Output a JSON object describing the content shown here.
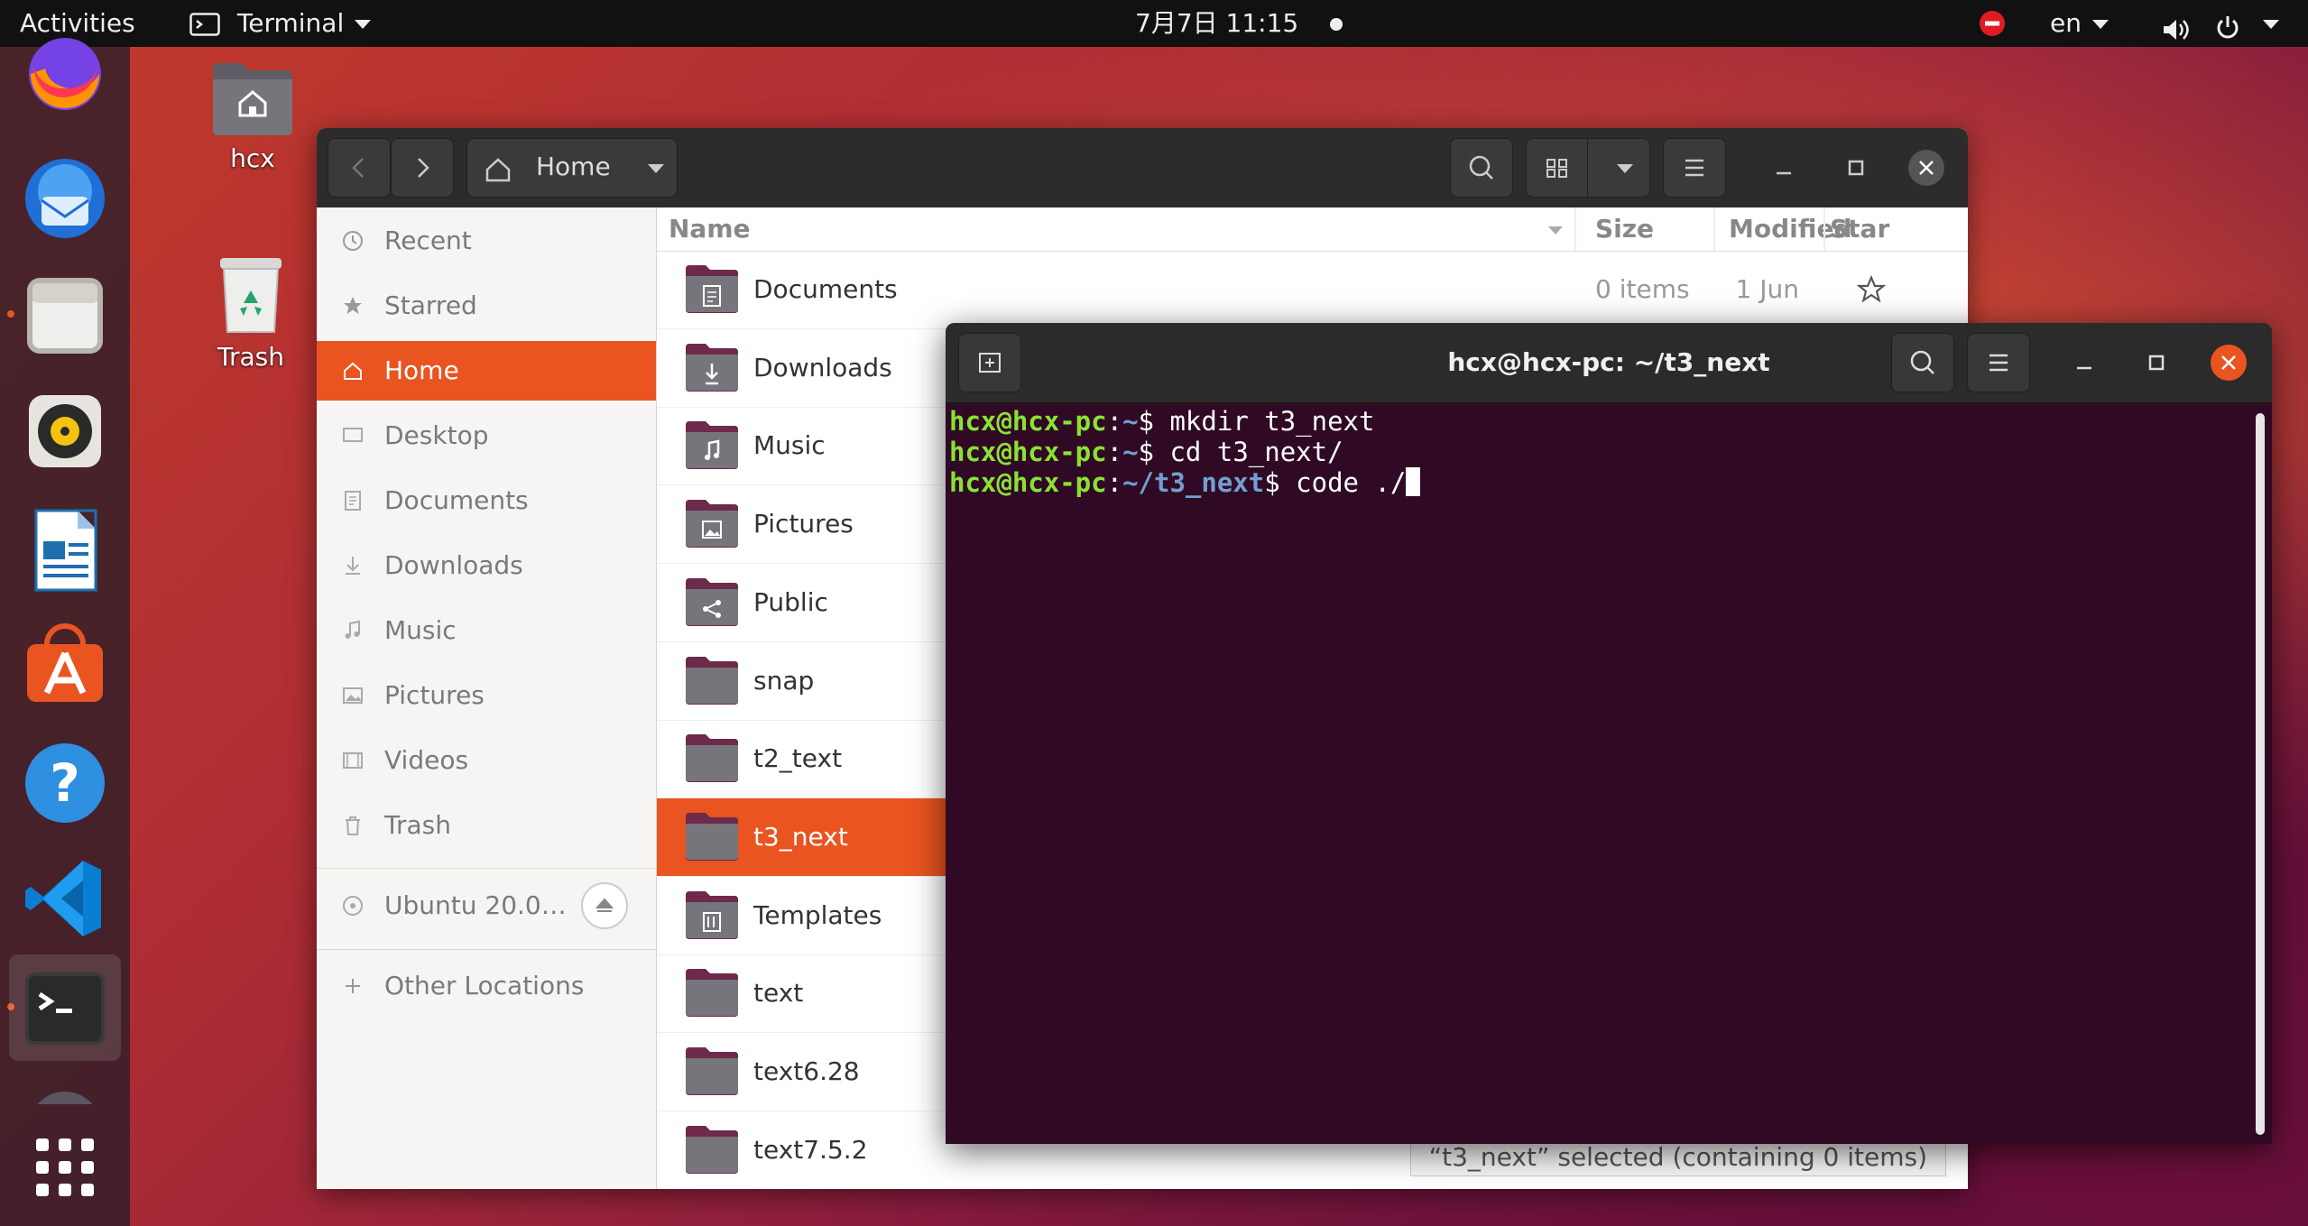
{
  "topbar": {
    "activities": "Activities",
    "app_menu": "Terminal",
    "clock": "7月7日  11:15",
    "language": "en"
  },
  "dock": {
    "apps": [
      "firefox-icon",
      "thunderbird-icon",
      "files-icon",
      "rhythmbox-icon",
      "libreoffice-writer-icon",
      "ubuntu-software-icon",
      "help-icon",
      "vscode-icon",
      "terminal-icon",
      "show-applications-icon"
    ]
  },
  "desktop": {
    "home_label": "hcx",
    "trash_label": "Trash"
  },
  "files": {
    "location": "Home",
    "sidebar": [
      {
        "label": "Recent",
        "icon": "clock-icon"
      },
      {
        "label": "Starred",
        "icon": "star-icon"
      },
      {
        "label": "Home",
        "icon": "home-icon",
        "active": true
      },
      {
        "label": "Desktop",
        "icon": "desktop-icon"
      },
      {
        "label": "Documents",
        "icon": "document-icon"
      },
      {
        "label": "Downloads",
        "icon": "download-icon"
      },
      {
        "label": "Music",
        "icon": "music-icon"
      },
      {
        "label": "Pictures",
        "icon": "picture-icon"
      },
      {
        "label": "Videos",
        "icon": "video-icon"
      },
      {
        "label": "Trash",
        "icon": "trash-icon"
      }
    ],
    "device": "Ubuntu 20.0…",
    "other_locations": "Other Locations",
    "columns": {
      "name": "Name",
      "size": "Size",
      "modified": "Modified",
      "star": "Star"
    },
    "rows": [
      {
        "name": "Documents",
        "size": "0 items",
        "modified": "1 Jun"
      },
      {
        "name": "Downloads"
      },
      {
        "name": "Music"
      },
      {
        "name": "Pictures"
      },
      {
        "name": "Public"
      },
      {
        "name": "snap"
      },
      {
        "name": "t2_text"
      },
      {
        "name": "t3_next",
        "selected": true
      },
      {
        "name": "Templates"
      },
      {
        "name": "text"
      },
      {
        "name": "text6.28"
      },
      {
        "name": "text7.5.2"
      }
    ],
    "status": "“t3_next” selected  (containing 0 items)"
  },
  "terminal": {
    "title": "hcx@hcx-pc: ~/t3_next",
    "lines": [
      {
        "user": "hcx@hcx-pc",
        "path": "~",
        "cmd": " mkdir t3_next"
      },
      {
        "user": "hcx@hcx-pc",
        "path": "~",
        "cmd": " cd t3_next/"
      },
      {
        "user": "hcx@hcx-pc",
        "path": "~/t3_next",
        "cmd": " code ./"
      }
    ]
  }
}
